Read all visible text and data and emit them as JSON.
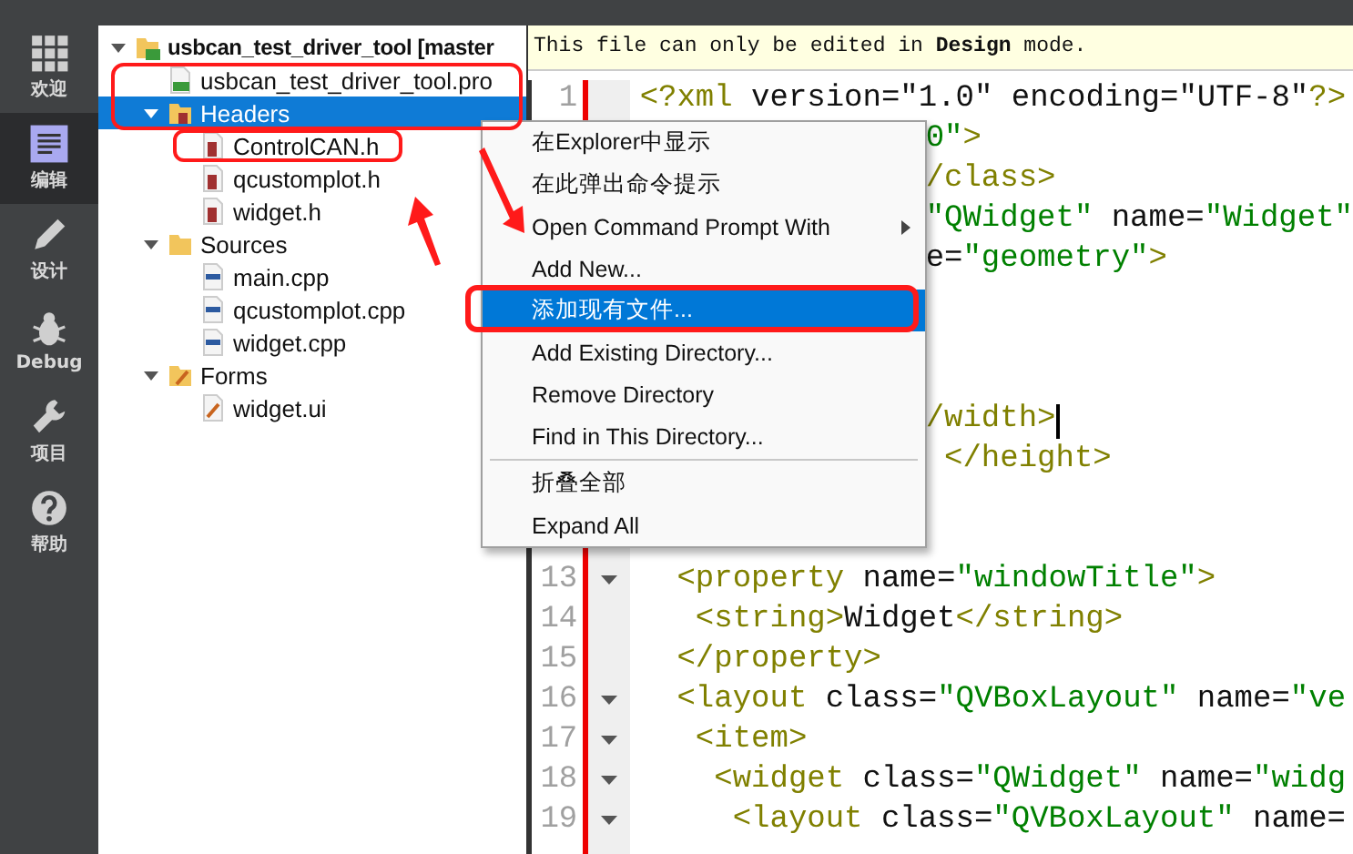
{
  "sidebar": {
    "items": [
      {
        "label": "欢迎",
        "kind": "welcome",
        "selected": false
      },
      {
        "label": "编辑",
        "kind": "edit",
        "selected": true
      },
      {
        "label": "设计",
        "kind": "design",
        "selected": false
      },
      {
        "label": "Debug",
        "kind": "debug",
        "selected": false
      },
      {
        "label": "项目",
        "kind": "projects",
        "selected": false
      },
      {
        "label": "帮助",
        "kind": "help",
        "selected": false
      }
    ]
  },
  "project_tree": [
    {
      "label": "usbcan_test_driver_tool [master",
      "kind": "project",
      "expanded": true,
      "selected": false,
      "children": [
        {
          "label": "usbcan_test_driver_tool.pro",
          "kind": "pro",
          "selected": false
        },
        {
          "label": "Headers",
          "kind": "folder-headers",
          "expanded": true,
          "selected": true,
          "children": [
            {
              "label": "ControlCAN.h",
              "kind": "header",
              "selected": false
            },
            {
              "label": "qcustomplot.h",
              "kind": "header",
              "selected": false
            },
            {
              "label": "widget.h",
              "kind": "header",
              "selected": false
            }
          ]
        },
        {
          "label": "Sources",
          "kind": "folder-sources",
          "expanded": true,
          "selected": false,
          "children": [
            {
              "label": "main.cpp",
              "kind": "source",
              "selected": false
            },
            {
              "label": "qcustomplot.cpp",
              "kind": "source",
              "selected": false
            },
            {
              "label": "widget.cpp",
              "kind": "source",
              "selected": false
            }
          ]
        },
        {
          "label": "Forms",
          "kind": "folder-forms",
          "expanded": true,
          "selected": false,
          "children": [
            {
              "label": "widget.ui",
              "kind": "form",
              "selected": false
            }
          ]
        }
      ]
    }
  ],
  "editor": {
    "info_bar": "This file can only be edited in **Design** mode.",
    "lines": [
      {
        "kind": "numbered",
        "number": "1",
        "tokens": [
          {
            "text": "<?xml",
            "kind": "tag"
          },
          {
            "text": " version=",
            "kind": "attr"
          },
          {
            "text": "\"1.0\"",
            "kind": "attr"
          },
          {
            "text": " encoding=",
            "kind": "attr"
          },
          {
            "text": "\"UTF-8\"",
            "kind": "attr"
          },
          {
            "text": "?>",
            "kind": "tag"
          }
        ]
      },
      {
        "kind": "hidden",
        "tokens": [
          {
            "text": "0\"",
            "kind": "str"
          },
          {
            "text": ">",
            "kind": "tag"
          }
        ]
      },
      {
        "kind": "hidden",
        "tokens": [
          {
            "text": "/class>",
            "kind": "tag"
          }
        ]
      },
      {
        "kind": "hidden",
        "tokens": [
          {
            "text": "\"QWidget\"",
            "kind": "str"
          },
          {
            "text": " name=",
            "kind": "attr"
          },
          {
            "text": "\"Widget\"",
            "kind": "str"
          }
        ]
      },
      {
        "kind": "hidden",
        "tokens": [
          {
            "text": "e=",
            "kind": "attr"
          },
          {
            "text": "\"geometry\"",
            "kind": "str"
          },
          {
            "text": ">",
            "kind": "tag"
          }
        ]
      },
      {
        "kind": "blank"
      },
      {
        "kind": "blank"
      },
      {
        "kind": "blank"
      },
      {
        "kind": "hidden",
        "cursor": true,
        "tokens": [
          {
            "text": "/width>",
            "kind": "tag"
          }
        ]
      },
      {
        "kind": "hidden",
        "tokens": [
          {
            "text": " </height>",
            "kind": "tag"
          }
        ]
      },
      {
        "kind": "blank"
      },
      {
        "kind": "blank"
      },
      {
        "kind": "numbered",
        "number": "13",
        "fold": true,
        "tokens": [
          {
            "text": "  <property",
            "kind": "tag"
          },
          {
            "text": " name=",
            "kind": "attr"
          },
          {
            "text": "\"windowTitle\"",
            "kind": "str"
          },
          {
            "text": ">",
            "kind": "tag"
          }
        ]
      },
      {
        "kind": "numbered",
        "number": "14",
        "tokens": [
          {
            "text": "   <string>",
            "kind": "tag"
          },
          {
            "text": "Widget",
            "kind": "attr"
          },
          {
            "text": "</string>",
            "kind": "tag"
          }
        ]
      },
      {
        "kind": "numbered",
        "number": "15",
        "tokens": [
          {
            "text": "  </property>",
            "kind": "tag"
          }
        ]
      },
      {
        "kind": "numbered",
        "number": "16",
        "fold": true,
        "tokens": [
          {
            "text": "  <layout",
            "kind": "tag"
          },
          {
            "text": " class=",
            "kind": "attr"
          },
          {
            "text": "\"QVBoxLayout\"",
            "kind": "str"
          },
          {
            "text": " name=",
            "kind": "attr"
          },
          {
            "text": "\"ve",
            "kind": "str"
          }
        ]
      },
      {
        "kind": "numbered",
        "number": "17",
        "fold": true,
        "tokens": [
          {
            "text": "   <item>",
            "kind": "tag"
          }
        ]
      },
      {
        "kind": "numbered",
        "number": "18",
        "fold": true,
        "tokens": [
          {
            "text": "    <widget",
            "kind": "tag"
          },
          {
            "text": " class=",
            "kind": "attr"
          },
          {
            "text": "\"QWidget\"",
            "kind": "str"
          },
          {
            "text": " name=",
            "kind": "attr"
          },
          {
            "text": "\"widg",
            "kind": "str"
          }
        ]
      },
      {
        "kind": "numbered",
        "number": "19",
        "fold": true,
        "tokens": [
          {
            "text": "     <layout",
            "kind": "tag"
          },
          {
            "text": " class=",
            "kind": "attr"
          },
          {
            "text": "\"QVBoxLayout\"",
            "kind": "str"
          },
          {
            "text": " name=",
            "kind": "attr"
          }
        ]
      }
    ]
  },
  "context_menu": {
    "items": [
      {
        "label": "在Explorer中显示",
        "kind": "item",
        "selected": false
      },
      {
        "label": "在此弹出命令提示",
        "kind": "item",
        "selected": false
      },
      {
        "label": "Open Command Prompt With",
        "kind": "submenu",
        "selected": false
      },
      {
        "label": "Add New...",
        "kind": "item",
        "selected": false
      },
      {
        "label": "添加现有文件...",
        "kind": "item",
        "selected": true
      },
      {
        "label": "Add Existing Directory...",
        "kind": "item",
        "selected": false
      },
      {
        "label": "Remove Directory",
        "kind": "item",
        "selected": false
      },
      {
        "label": "Find in This Directory...",
        "kind": "item",
        "selected": false
      },
      {
        "kind": "separator"
      },
      {
        "label": "折叠全部",
        "kind": "item",
        "selected": false
      },
      {
        "label": "Expand All",
        "kind": "item",
        "selected": false
      }
    ]
  }
}
